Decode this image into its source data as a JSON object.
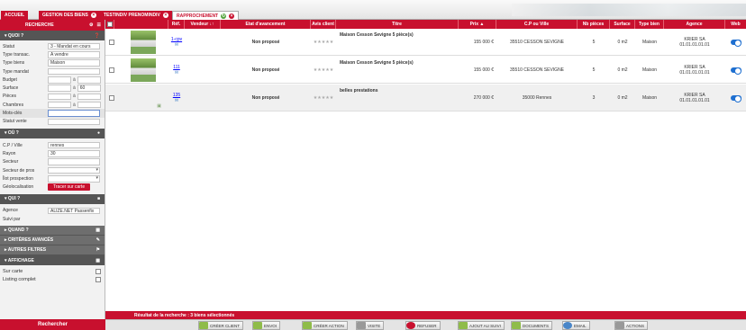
{
  "tabs": [
    {
      "label": "ACCUEIL",
      "active": false
    },
    {
      "label": "GESTION DES BIENS",
      "active": false
    },
    {
      "label": "TESTINDIV PRENOMINDIV",
      "active": false
    },
    {
      "label": "RAPPROCHEMENT",
      "active": true
    }
  ],
  "sidebar": {
    "search_title": "RECHERCHE",
    "quoi": "QUOI ?",
    "fields": {
      "statut": {
        "label": "Statut",
        "value": "3 - Mandat en cours"
      },
      "type_transac": {
        "label": "Type transac.",
        "value": "A vendre"
      },
      "type_biens": {
        "label": "Type biens",
        "value": "Maison"
      },
      "type_mandat": {
        "label": "Type mandat",
        "value": ""
      },
      "budget": {
        "label": "Budget",
        "from": "",
        "sep": "à",
        "to": ""
      },
      "surface": {
        "label": "Surface",
        "from": "",
        "sep": "à",
        "to": "60"
      },
      "pieces": {
        "label": "Pièces",
        "from": "",
        "sep": "à",
        "to": ""
      },
      "chambres": {
        "label": "Chambres",
        "from": "",
        "sep": "à",
        "to": ""
      },
      "mots_cles": {
        "label": "Mots-clés",
        "value": ""
      },
      "statut_vente": {
        "label": "Statut vente",
        "value": ""
      }
    },
    "ou": "OÙ ?",
    "ou_fields": {
      "cp_ville": {
        "label": "C.P / Ville",
        "value": "rennes"
      },
      "rayon": {
        "label": "Rayon",
        "value": "30"
      },
      "secteur": {
        "label": "Secteur",
        "value": ""
      },
      "secteur_pros": {
        "label": "Secteur de pros",
        "value": ""
      },
      "ilot": {
        "label": "Îlot prospection",
        "value": ""
      },
      "geoloc": {
        "label": "Géolocalisation",
        "button": "Tracer sur carte"
      }
    },
    "qui": "QUI ?",
    "qui_fields": {
      "agence": {
        "label": "Agence",
        "value": "ALIZE.NET Passenfix"
      },
      "suivi_par": {
        "label": "Suivi par",
        "value": ""
      }
    },
    "quand": "QUAND ?",
    "criteres": "CRITÈRES AVANCÉS",
    "autres": "AUTRES FILTRES",
    "affichage": "AFFICHAGE",
    "sur_carte": "Sur carte",
    "listing": "Listing complet",
    "search_button": "Rechercher"
  },
  "table": {
    "headers": [
      "Réf.",
      "Vendeur ↓↑",
      "Etat d'avancement",
      "Avis client",
      "Titre",
      "Prix ▲",
      "C.P ou Ville",
      "Nb pièces",
      "Surface",
      "Type bien",
      "Agence",
      "Web"
    ],
    "rows": [
      {
        "ref": "1-cpv",
        "etat": "Non proposé",
        "avis": "★★★★★",
        "titre": "Maison Cesson Sevigne 5 pièce(s)",
        "prix": "155 000 €",
        "ville": "35510 CESSON SEVIGNE",
        "pieces": "5",
        "surface": "0 m2",
        "type": "Maison",
        "agence": "KRIER SA",
        "agence_tel": "01.01.01.01.01",
        "has_photo": true
      },
      {
        "ref": "111",
        "etat": "Non proposé",
        "avis": "★★★★★",
        "titre": "Maison Cesson Sevigne 5 pièce(s)",
        "prix": "155 000 €",
        "ville": "35510 CESSON SEVIGNE",
        "pieces": "5",
        "surface": "0 m2",
        "type": "Maison",
        "agence": "KRIER SA",
        "agence_tel": "01.01.01.01.01",
        "has_photo": true
      },
      {
        "ref": "135",
        "etat": "Non proposé",
        "avis": "★★★★★",
        "titre": "belles prestations",
        "prix": "270 000 €",
        "ville": "35000 Rennes",
        "pieces": "3",
        "surface": "0 m2",
        "type": "Maison",
        "agence": "KRIER SA",
        "agence_tel": "01.01.01.01.01",
        "has_photo": false
      }
    ]
  },
  "result_text": "Résultat de la recherche : 3 biens sélectionnés",
  "actions": [
    "CRÉER CLIENT",
    "ENVOI",
    "CRÉER ACTION",
    "VISITE",
    "REFUSER",
    "AJOUT AU SUIVI",
    "DOCUMENTS",
    "EMAIL",
    "ACTIONS"
  ],
  "colors": {
    "brand": "#c8102e",
    "toggle": "#1e6fd0"
  }
}
